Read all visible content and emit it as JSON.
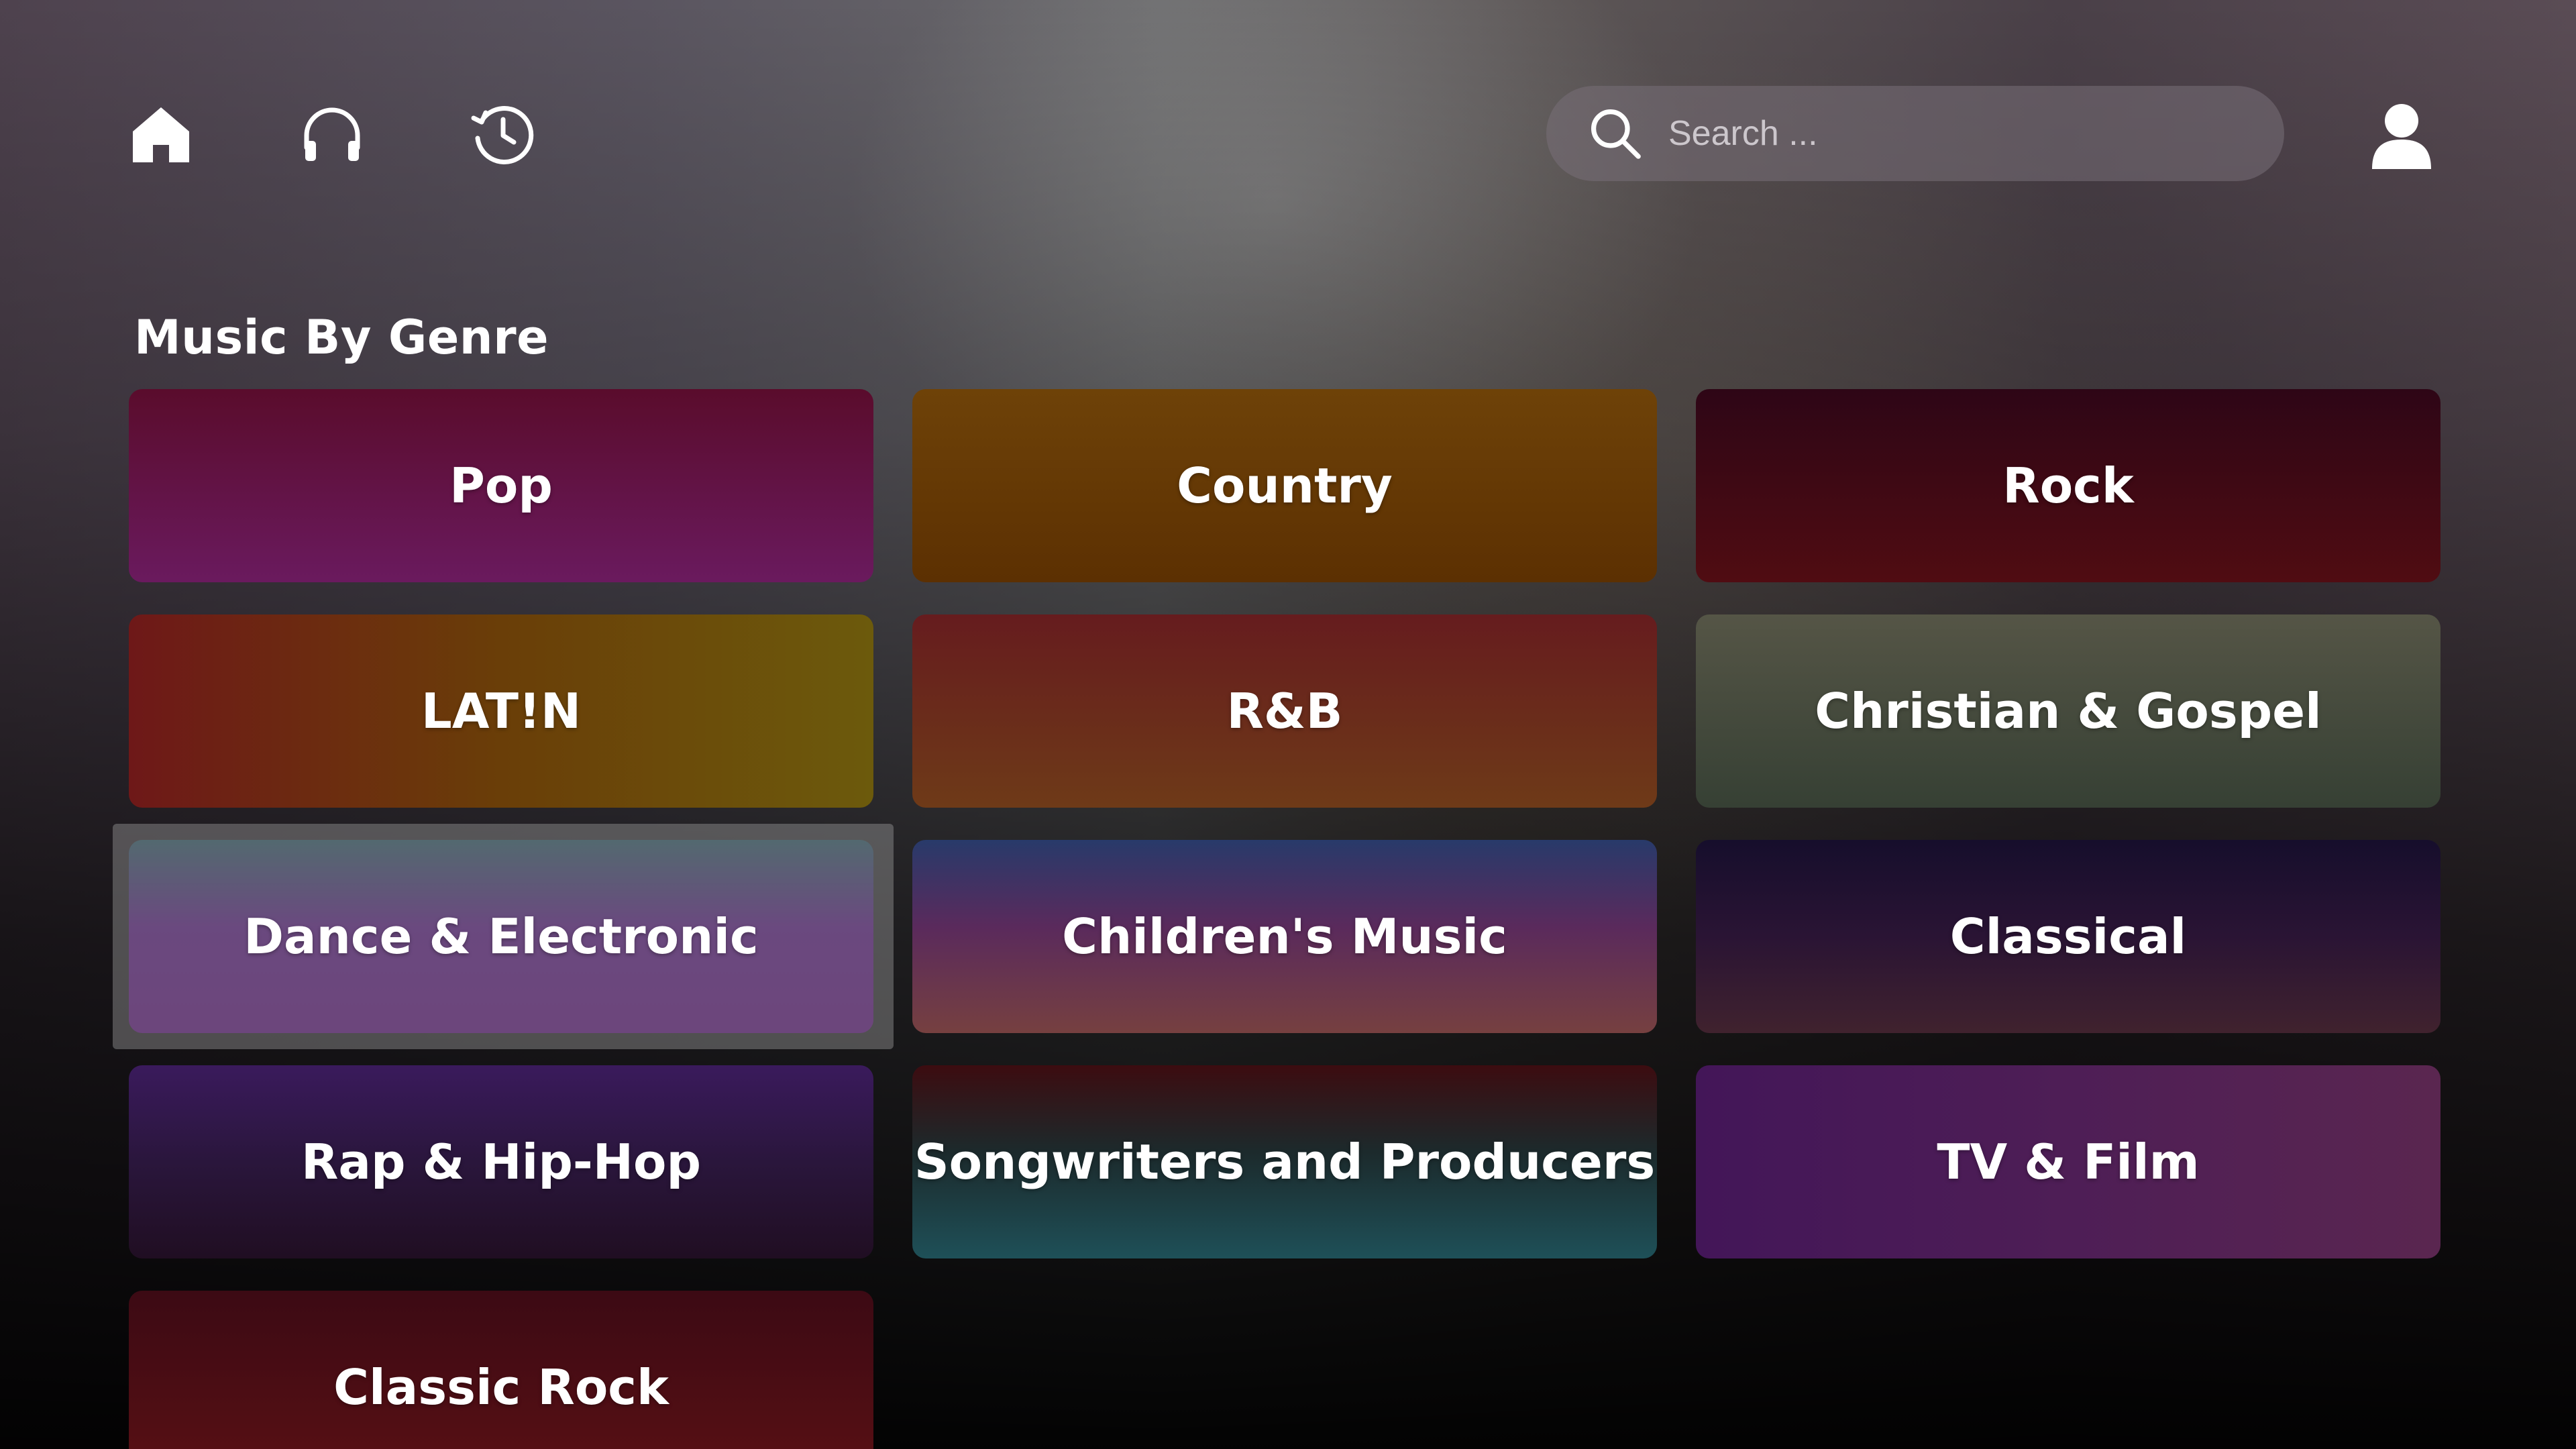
{
  "nav": {
    "items": [
      {
        "name": "home-icon"
      },
      {
        "name": "headphones-icon"
      },
      {
        "name": "history-icon"
      }
    ]
  },
  "search": {
    "placeholder": "Search ...",
    "value": ""
  },
  "account": {
    "icon": "user-avatar-icon"
  },
  "section": {
    "title": "Music By Genre"
  },
  "genres": [
    {
      "label": "Pop"
    },
    {
      "label": "Country"
    },
    {
      "label": "Rock"
    },
    {
      "label": "LAT!N"
    },
    {
      "label": "R&B"
    },
    {
      "label": "Christian & Gospel"
    },
    {
      "label": "Dance & Electronic",
      "focused": true
    },
    {
      "label": "Children's Music"
    },
    {
      "label": "Classical"
    },
    {
      "label": "Rap & Hip-Hop"
    },
    {
      "label": "Songwriters and Producers"
    },
    {
      "label": "TV & Film"
    },
    {
      "label": "Classic Rock"
    }
  ],
  "colors": {
    "icon": "#ffffff",
    "icon_dim": "#e6e0e6",
    "focus_ring": "#969696"
  }
}
